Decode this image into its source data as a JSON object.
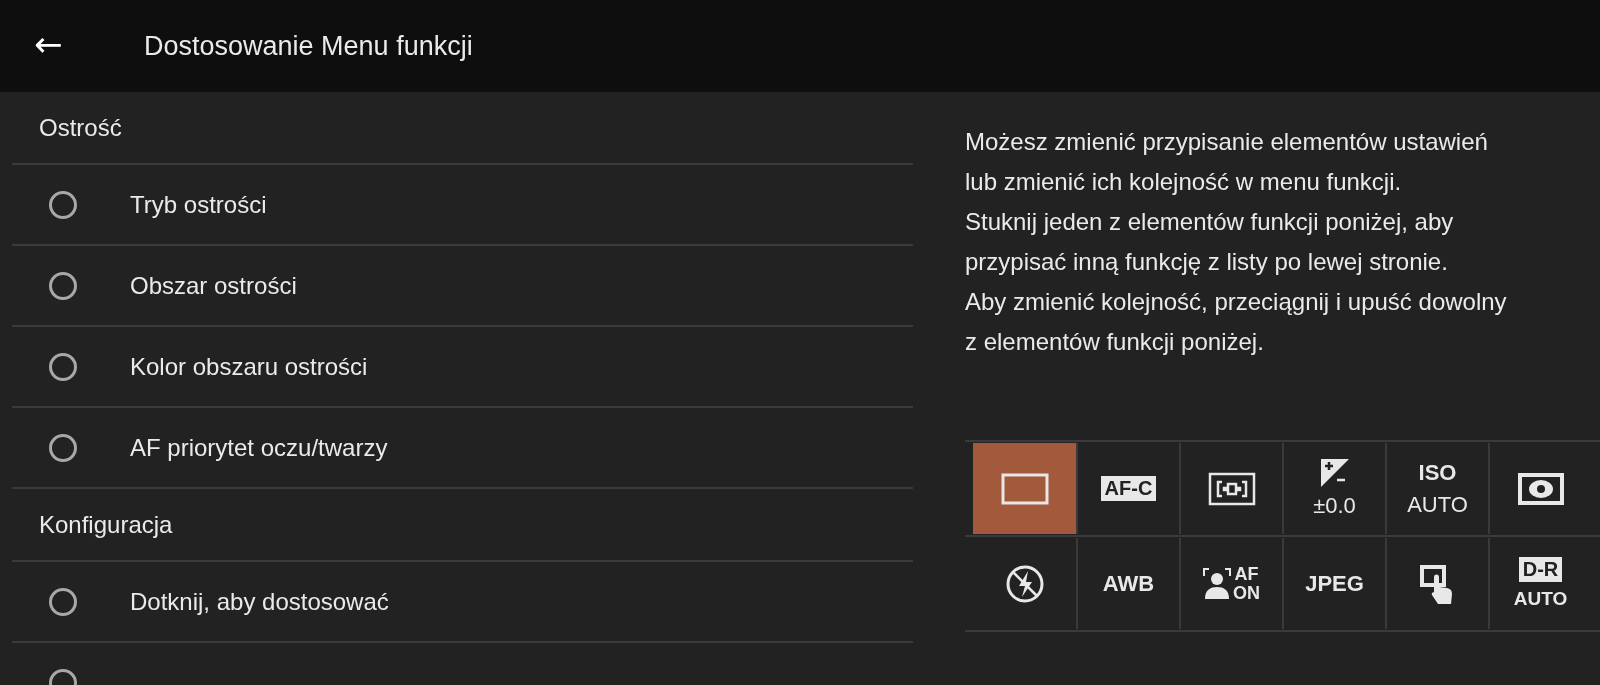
{
  "header": {
    "back": "←",
    "title": "Dostosowanie Menu funkcji"
  },
  "sections": [
    {
      "title": "Ostrość",
      "items": [
        {
          "label": "Tryb ostrości",
          "checked": false
        },
        {
          "label": "Obszar ostrości",
          "checked": false
        },
        {
          "label": "Kolor obszaru ostrości",
          "checked": false
        },
        {
          "label": "AF priorytet oczu/twarzy",
          "checked": false
        }
      ]
    },
    {
      "title": "Konfiguracja",
      "items": [
        {
          "label": "Dotknij, aby dostosować",
          "checked": false
        },
        {
          "checked": false
        }
      ]
    }
  ],
  "description": [
    "Możesz zmienić przypisanie elementów ustawień",
    "lub zmienić ich kolejność w menu funkcji.",
    "Stuknij jeden z elementów funkcji poniżej, aby",
    "przypisać inną funkcję z listy po lewej stronie.",
    "Aby zmienić kolejność, przeciągnij i upuść dowolny",
    "z elementów funkcji poniżej."
  ],
  "function_rows": [
    {
      "cells": [
        {
          "kind": "frame",
          "selected": true
        },
        {
          "kind": "badge",
          "label": "AF-C",
          "selected": false
        },
        {
          "kind": "focus",
          "selected": false
        },
        {
          "kind": "exposure",
          "sub": "±0.0",
          "selected": false
        },
        {
          "kind": "text",
          "label": "ISO",
          "sub": "AUTO",
          "selected": false
        },
        {
          "kind": "metering",
          "selected": false
        }
      ]
    },
    {
      "cells": [
        {
          "kind": "flash",
          "selected": false
        },
        {
          "kind": "text",
          "label": "AWB",
          "selected": false
        },
        {
          "kind": "face",
          "label": "AF",
          "sub": "ON",
          "selected": false
        },
        {
          "kind": "text",
          "label": "JPEG",
          "selected": false
        },
        {
          "kind": "touch",
          "selected": false
        },
        {
          "kind": "badge",
          "label": "D-R",
          "sub": "AUTO",
          "selected": false
        }
      ]
    }
  ]
}
